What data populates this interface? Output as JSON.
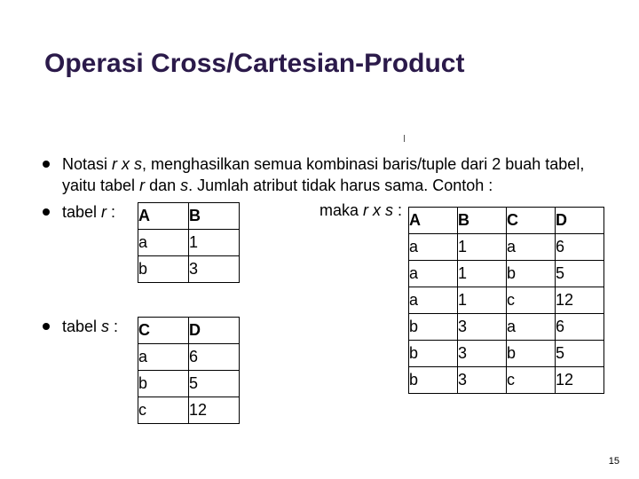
{
  "title": "Operasi Cross/Cartesian-Product",
  "bullets": {
    "b1_before": "Notasi ",
    "b1_expr": "r x s",
    "b1_mid": ", menghasilkan semua kombinasi baris/tuple dari 2 buah tabel, yaitu tabel ",
    "b1_r": "r",
    "b1_and": " dan ",
    "b1_s": "s",
    "b1_after": ". Jumlah atribut tidak harus sama. Contoh :",
    "b2_before": "tabel ",
    "b2_r": "r",
    "b2_after": " :",
    "b3_before": "tabel ",
    "b3_s": "s",
    "b3_after": " :",
    "maka_before": "maka ",
    "maka_expr": "r x s",
    "maka_after": " :"
  },
  "table_r": {
    "headers": [
      "A",
      "B"
    ],
    "rows": [
      [
        "a",
        "1"
      ],
      [
        "b",
        "3"
      ]
    ]
  },
  "table_s": {
    "headers": [
      "C",
      "D"
    ],
    "rows": [
      [
        "a",
        "6"
      ],
      [
        "b",
        "5"
      ],
      [
        "c",
        "12"
      ]
    ]
  },
  "table_rs": {
    "headers": [
      "A",
      "B",
      "C",
      "D"
    ],
    "rows": [
      [
        "a",
        "1",
        "a",
        "6"
      ],
      [
        "a",
        "1",
        "b",
        "5"
      ],
      [
        "a",
        "1",
        "c",
        "12"
      ],
      [
        "b",
        "3",
        "a",
        "6"
      ],
      [
        "b",
        "3",
        "b",
        "5"
      ],
      [
        "b",
        "3",
        "c",
        "12"
      ]
    ]
  },
  "page_number": "15"
}
